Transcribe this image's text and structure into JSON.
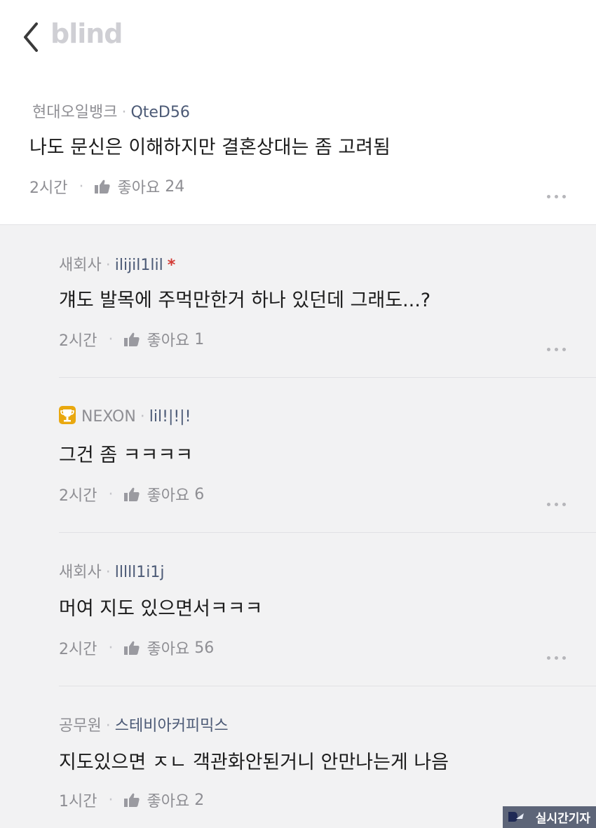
{
  "header": {
    "logo": "blind"
  },
  "post": {
    "company": "현대오일뱅크",
    "nickname": "QteD56",
    "text": "나도 문신은 이해하지만 결혼상대는 좀 고려됨",
    "time": "2시간",
    "like_label": "좋아요",
    "like_count": "24"
  },
  "comments": [
    {
      "company": "새회사",
      "nickname": "ilijil1lil",
      "flag": "*",
      "text": "걔도 발목에 주먹만한거 하나 있던데 그래도...?",
      "time": "2시간",
      "like_label": "좋아요",
      "like_count": "1"
    },
    {
      "company": "NEXON",
      "nickname": "lil!|!|!",
      "text": "그건 좀 ㅋㅋㅋㅋ",
      "time": "2시간",
      "like_label": "좋아요",
      "like_count": "6"
    },
    {
      "company": "새회사",
      "nickname": "lllll1i1j",
      "text": "머여 지도 있으면서ㅋㅋㅋ",
      "time": "2시간",
      "like_label": "좋아요",
      "like_count": "56"
    },
    {
      "company": "공무원",
      "nickname": "스테비아커피믹스",
      "text": "지도있으면 ㅈㄴ 객관화안된거니 안만나는게 나음",
      "time": "1시간",
      "like_label": "좋아요",
      "like_count": "2"
    }
  ],
  "watermark": {
    "text": "실시간기자"
  },
  "icons": {
    "back": "chevron-left-icon",
    "like": "thumbs-up-icon",
    "more": "more-dots-icon",
    "badge": "trophy-icon"
  },
  "colors": {
    "nickname": "#4c5a76",
    "flag": "#d33b35",
    "badge": "#e9a80f"
  }
}
